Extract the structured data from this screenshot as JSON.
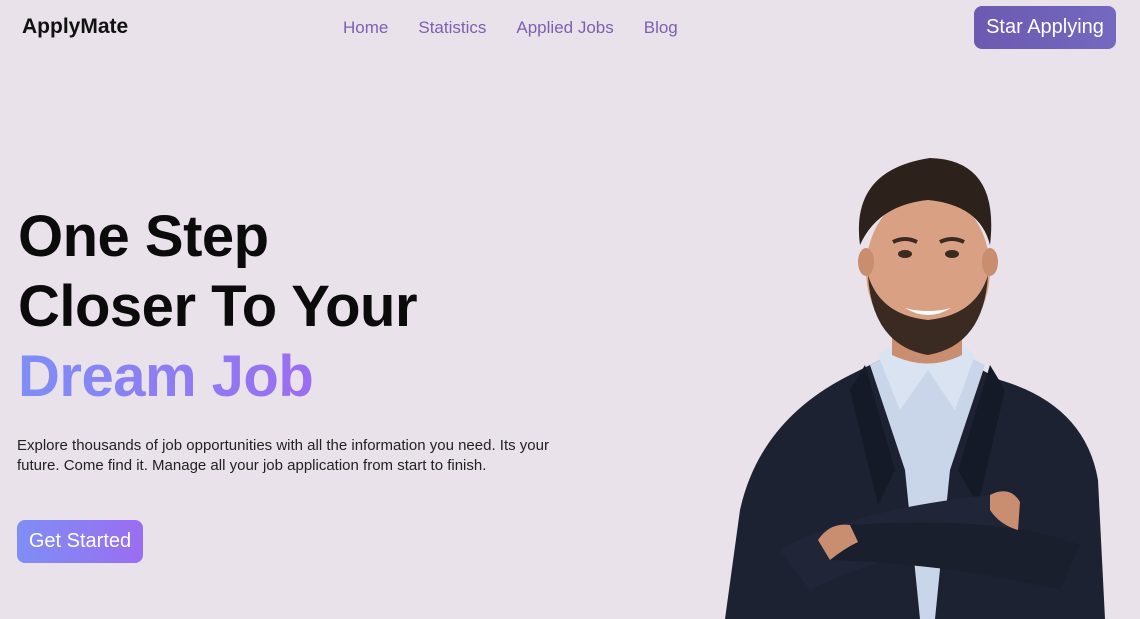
{
  "header": {
    "logo": "ApplyMate",
    "nav": [
      "Home",
      "Statistics",
      "Applied Jobs",
      "Blog"
    ],
    "cta_label": "Star Applying"
  },
  "hero": {
    "title_line1": "One Step",
    "title_line2": "Closer To Your",
    "title_accent": "Dream Job",
    "description": "Explore thousands of job opportunities with all the information you need. Its your future. Come find it. Manage all your job application from start to finish.",
    "cta_label": "Get Started"
  },
  "colors": {
    "background": "#e9e2eb",
    "nav_link": "#7c5fb0",
    "accent_start": "#7f8ef5",
    "accent_end": "#9b6df0",
    "top_button": "#6b5ab0"
  }
}
